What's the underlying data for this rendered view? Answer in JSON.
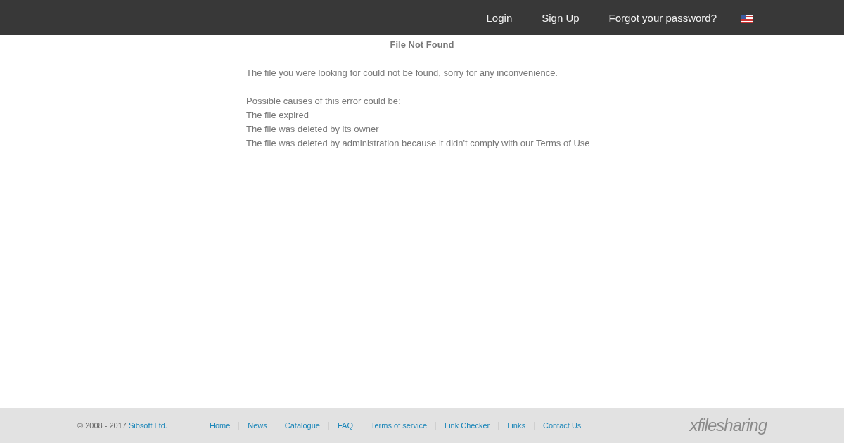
{
  "header": {
    "nav": [
      "Login",
      "Sign Up",
      "Forgot your password?"
    ]
  },
  "content": {
    "title": "File Not Found",
    "message": "The file you were looking for could not be found, sorry for any inconvenience.",
    "causes_heading": "Possible causes of this error could be:",
    "causes": [
      "The file expired",
      "The file was deleted by its owner",
      "The file was deleted by administration because it didn't comply with our Terms of Use"
    ]
  },
  "footer": {
    "copyright": "© 2008 - 2017",
    "company": "Sibsoft Ltd.",
    "links": [
      "Home",
      "News",
      "Catalogue",
      "FAQ",
      "Terms of service",
      "Link Checker",
      "Links",
      "Contact Us"
    ],
    "logo": "x**file**sharing"
  }
}
